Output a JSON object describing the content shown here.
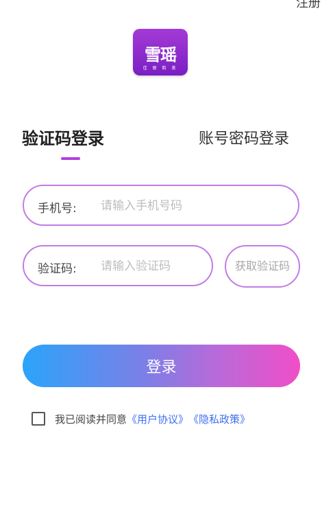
{
  "header": {
    "top_link": "注册"
  },
  "logo": {
    "text": "雪瑶",
    "sub": "佳 丽 韵 美"
  },
  "tabs": {
    "active": "验证码登录",
    "inactive": "账号密码登录"
  },
  "form": {
    "phone_label": "手机号:",
    "phone_placeholder": "请输入手机号码",
    "code_label": "验证码:",
    "code_placeholder": "请输入验证码",
    "get_code_label": "获取验证码"
  },
  "login_button": "登录",
  "agreement": {
    "text": "我已阅读并同意",
    "user_agreement": "《用户协议》",
    "privacy_policy": "《隐私政策》"
  },
  "colors": {
    "accent": "#b23fe0",
    "field_border": "#c27be6",
    "gradient_start": "#2aa4fa",
    "gradient_end": "#f04ec7",
    "link": "#3d6ff0"
  }
}
